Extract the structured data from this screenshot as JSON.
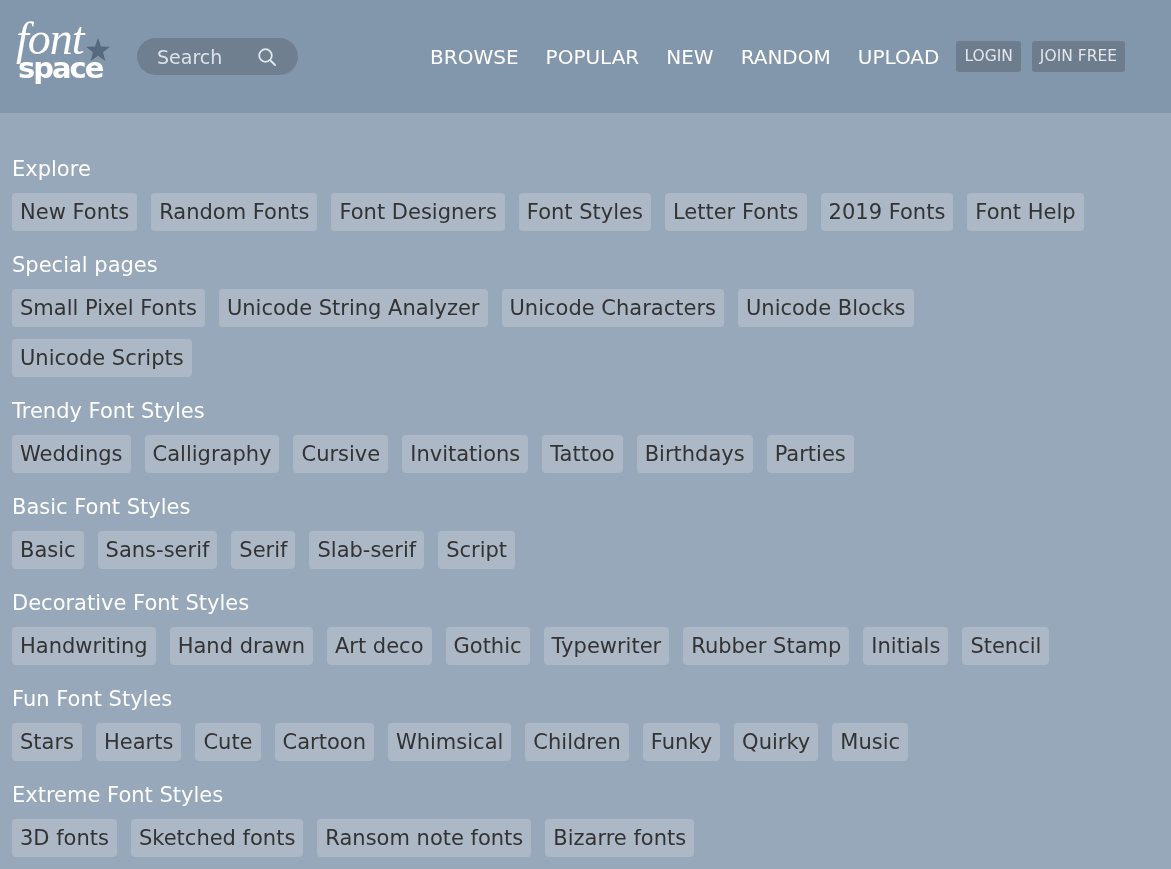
{
  "header": {
    "logo": {
      "line_1": "font",
      "line_2": "space"
    },
    "search": {
      "placeholder": "Search"
    },
    "nav": [
      "BROWSE",
      "POPULAR",
      "NEW",
      "RANDOM",
      "UPLOAD"
    ],
    "buttons": [
      "LOGIN",
      "JOIN FREE"
    ]
  },
  "sections": [
    {
      "title": "Explore",
      "tags": [
        "New Fonts",
        "Random Fonts",
        "Font Designers",
        "Font Styles",
        "Letter Fonts",
        "2019 Fonts",
        "Font Help"
      ]
    },
    {
      "title": "Special pages",
      "tags": [
        "Small Pixel Fonts",
        "Unicode String Analyzer",
        "Unicode Characters",
        "Unicode Blocks",
        "Unicode Scripts"
      ]
    },
    {
      "title": "Trendy Font Styles",
      "tags": [
        "Weddings",
        "Calligraphy",
        "Cursive",
        "Invitations",
        "Tattoo",
        "Birthdays",
        "Parties"
      ]
    },
    {
      "title": "Basic Font Styles",
      "tags": [
        "Basic",
        "Sans-serif",
        "Serif",
        "Slab-serif",
        "Script"
      ]
    },
    {
      "title": "Decorative Font Styles",
      "tags": [
        "Handwriting",
        "Hand drawn",
        "Art deco",
        "Gothic",
        "Typewriter",
        "Rubber Stamp",
        "Initials",
        "Stencil"
      ]
    },
    {
      "title": "Fun Font Styles",
      "tags": [
        "Stars",
        "Hearts",
        "Cute",
        "Cartoon",
        "Whimsical",
        "Children",
        "Funky",
        "Quirky",
        "Music"
      ]
    },
    {
      "title": "Extreme Font Styles",
      "tags": [
        "3D fonts",
        "Sketched fonts",
        "Ransom note fonts",
        "Bizarre fonts"
      ]
    }
  ]
}
